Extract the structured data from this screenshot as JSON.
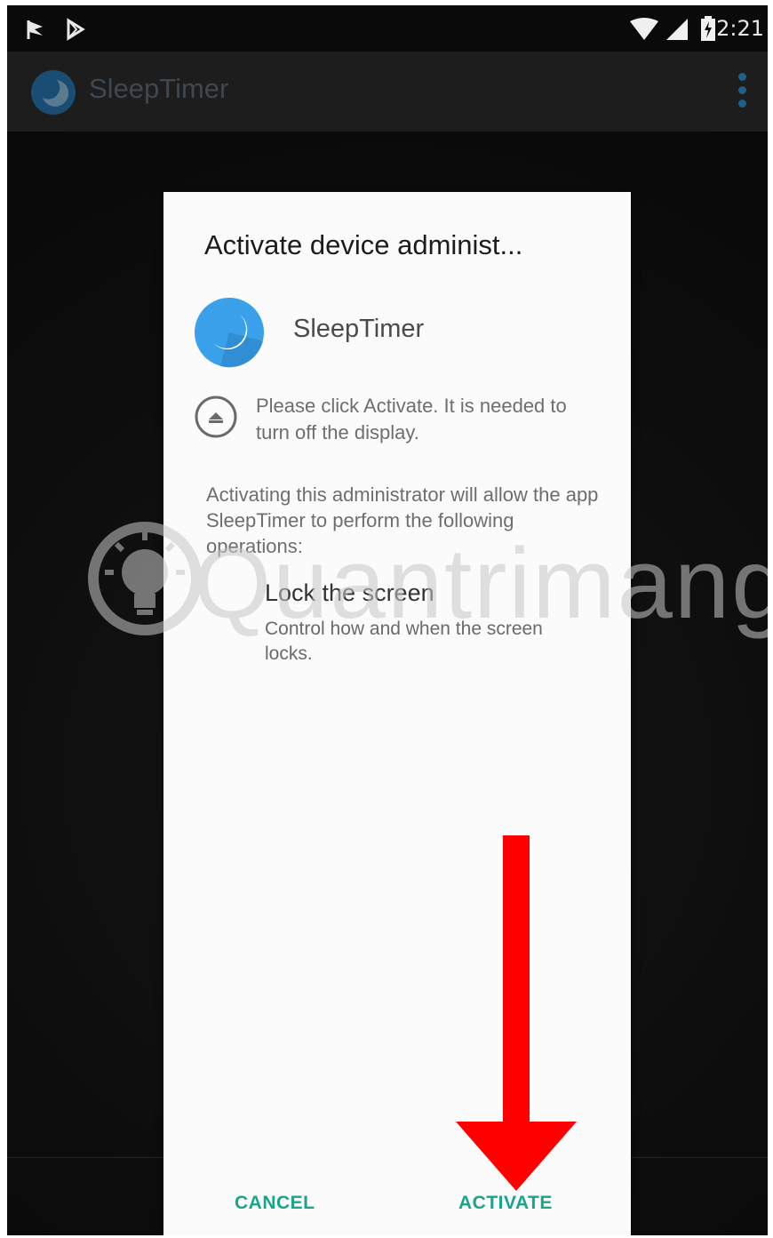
{
  "status_bar": {
    "time": "2:21",
    "icons": [
      "notification-flag-icon",
      "play-store-icon",
      "wifi-icon",
      "signal-icon",
      "battery-icon"
    ]
  },
  "action_bar": {
    "title": "SleepTimer",
    "menu_icon": "overflow-menu-icon"
  },
  "dialog": {
    "title": "Activate device administ...",
    "app_name": "SleepTimer",
    "admin_description": "Please click Activate. It is needed to turn off the display.",
    "warning_text": "Activating this administrator will allow the app SleepTimer to perform the following operations:",
    "policy": {
      "title": "Lock the screen",
      "description": "Control how and when the screen locks."
    },
    "buttons": {
      "cancel": "CANCEL",
      "activate": "ACTIVATE"
    }
  },
  "overlay": {
    "watermark": "Quantrimang",
    "arrow_color": "#ff0000"
  },
  "colors": {
    "accent": "#1aa58a",
    "app_icon_blue": "#3aa0ea",
    "background": "#111111"
  }
}
